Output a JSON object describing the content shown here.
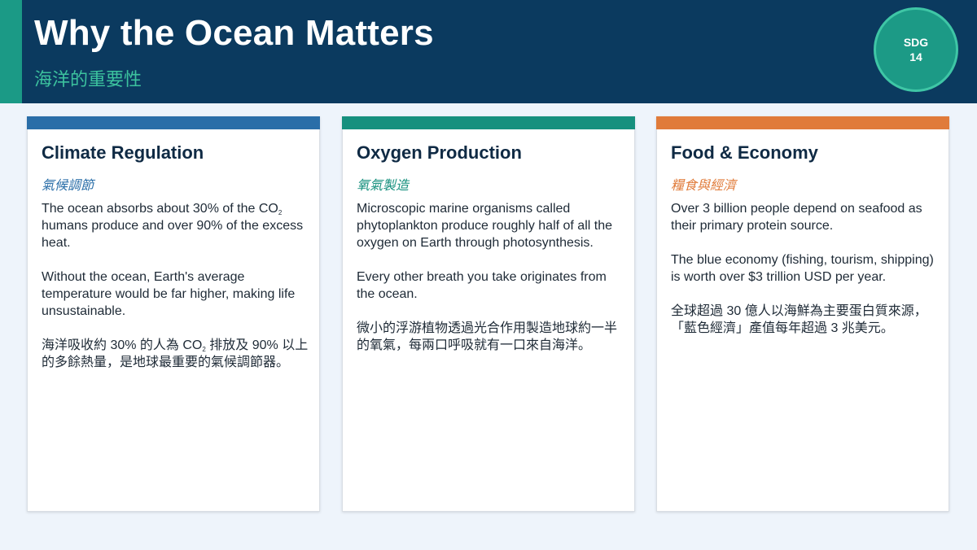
{
  "header": {
    "title": "Why the Ocean Matters",
    "subtitle": "海洋的重要性",
    "badge": {
      "line1": "SDG",
      "line2": "14"
    }
  },
  "colors": {
    "header_bg": "#0b3a5f",
    "header_accent": "#1b9a86",
    "subtitle": "#3cc29e",
    "badge_fill": "#1c9a86",
    "card1_accent": "#2a6ea8",
    "card2_accent": "#16907e",
    "card3_accent": "#e07b3a"
  },
  "cards": [
    {
      "title": "Climate Regulation",
      "subtitle": "氣候調節",
      "p1_pre": "The ocean absorbs about 30% of the CO",
      "p1_sub": "2",
      "p1_post": " humans produce and over 90% of the excess heat.",
      "p2": "Without the ocean, Earth's average temperature would be far higher, making life unsustainable.",
      "p3_pre": "海洋吸收約 30% 的人為 CO",
      "p3_sub": "2",
      "p3_post": " 排放及 90% 以上的多餘熱量，是地球最重要的氣候調節器。"
    },
    {
      "title": "Oxygen Production",
      "subtitle": "氧氣製造",
      "p1": "Microscopic marine organisms called phytoplankton produce roughly half of all the oxygen on Earth through photosynthesis.",
      "p2": "Every other breath you take originates from the ocean.",
      "p3": "微小的浮游植物透過光合作用製造地球約一半的氧氣，每兩口呼吸就有一口來自海洋。"
    },
    {
      "title": "Food & Economy",
      "subtitle": "糧食與經濟",
      "p1": "Over 3 billion people depend on seafood as their primary protein source.",
      "p2": "The blue economy (fishing, tourism, shipping) is worth over $3 trillion USD per year.",
      "p3": "全球超過 30 億人以海鮮為主要蛋白質來源，「藍色經濟」產值每年超過 3 兆美元。"
    }
  ]
}
